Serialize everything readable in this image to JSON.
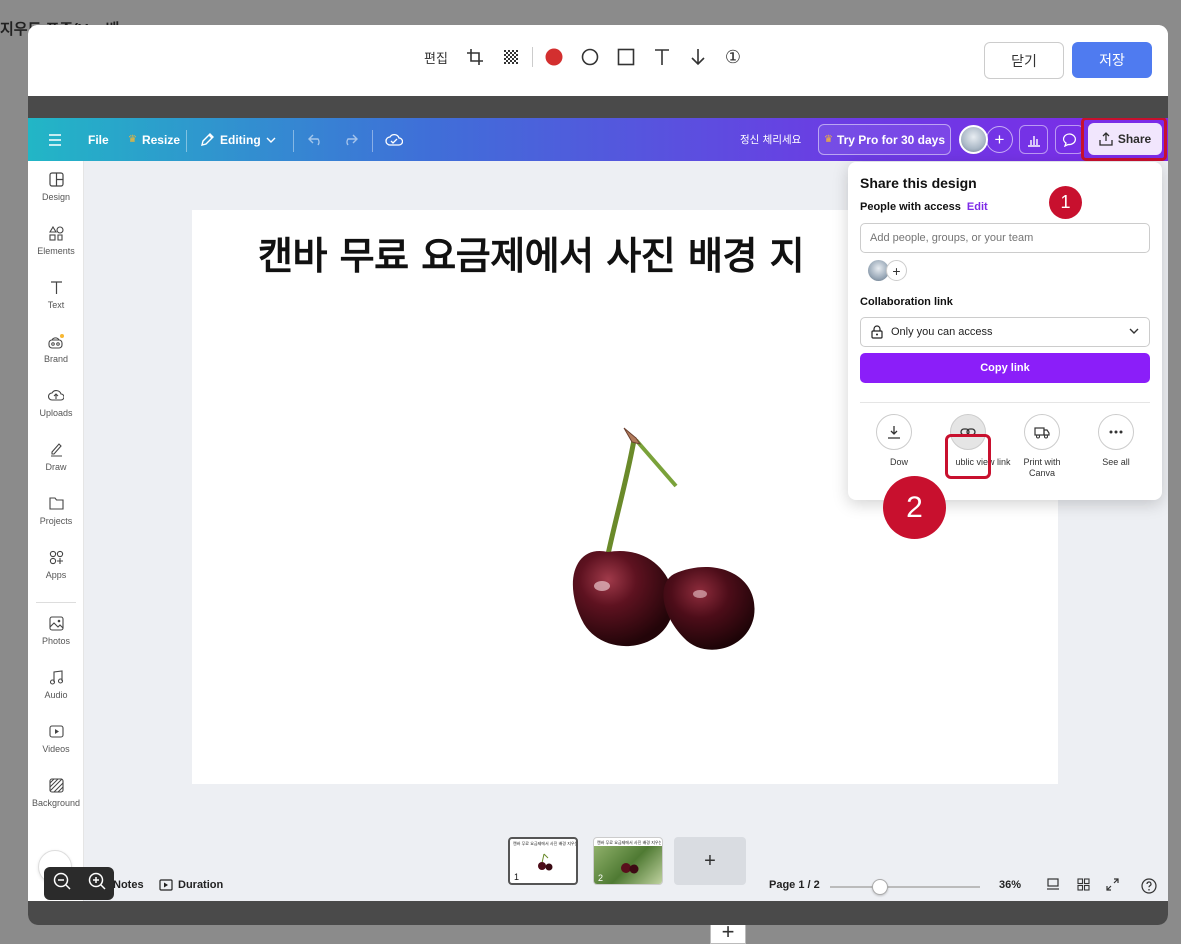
{
  "background": {
    "partial_title": "지우도 표준(Ver 배",
    "plus_glyph": "+"
  },
  "modal_toolbar": {
    "edit_label": "편집",
    "number_circle": "①",
    "close_label": "닫기",
    "save_label": "저장",
    "pen_color": "#d32f2f"
  },
  "canva_topbar": {
    "file_label": "File",
    "resize_label": "Resize",
    "editing_label": "Editing",
    "design_title": "정신 체리세요",
    "try_pro_label": "Try Pro for 30 days",
    "share_label": "Share",
    "gradient_start": "#22b6c6",
    "gradient_end": "#7d2ae8"
  },
  "sidebar": {
    "items": [
      {
        "label": "Design",
        "icon": "design-icon"
      },
      {
        "label": "Elements",
        "icon": "elements-icon"
      },
      {
        "label": "Text",
        "icon": "text-icon"
      },
      {
        "label": "Brand",
        "icon": "brand-icon"
      },
      {
        "label": "Uploads",
        "icon": "uploads-icon"
      },
      {
        "label": "Draw",
        "icon": "draw-icon"
      },
      {
        "label": "Projects",
        "icon": "projects-icon"
      },
      {
        "label": "Apps",
        "icon": "apps-icon"
      },
      {
        "label": "Photos",
        "icon": "photos-icon"
      },
      {
        "label": "Audio",
        "icon": "audio-icon"
      },
      {
        "label": "Videos",
        "icon": "videos-icon"
      },
      {
        "label": "Background",
        "icon": "background-icon"
      }
    ]
  },
  "canvas": {
    "page_title": "캔바 무료 요금제에서 사진 배경 지"
  },
  "share_panel": {
    "title": "Share this design",
    "people_label": "People with access",
    "edit_link": "Edit",
    "input_placeholder": "Add people, groups, or your team",
    "collab_label": "Collaboration link",
    "access_value": "Only you can access",
    "copy_link_label": "Copy link",
    "actions": [
      {
        "label": "Dow",
        "icon": "download-icon"
      },
      {
        "label": "ublic view link",
        "icon": "link-icon"
      },
      {
        "label": "Print with\nCanva",
        "icon": "truck-icon"
      },
      {
        "label": "See all",
        "icon": "more-icon"
      }
    ],
    "accent": "#8b1ef9"
  },
  "annotations": {
    "marker_1": "1",
    "marker_2": "2",
    "highlight_color": "#c8102e"
  },
  "pages_strip": {
    "thumb_1_num": "1",
    "thumb_2_num": "2",
    "thumb_title": "캔바 무료 요금제에서 사진 배경 지우는 방",
    "add_label": "+"
  },
  "bottom_bar": {
    "notes_label": "Notes",
    "duration_label": "Duration",
    "page_indicator": "Page 1 / 2",
    "zoom_level": "36%"
  }
}
